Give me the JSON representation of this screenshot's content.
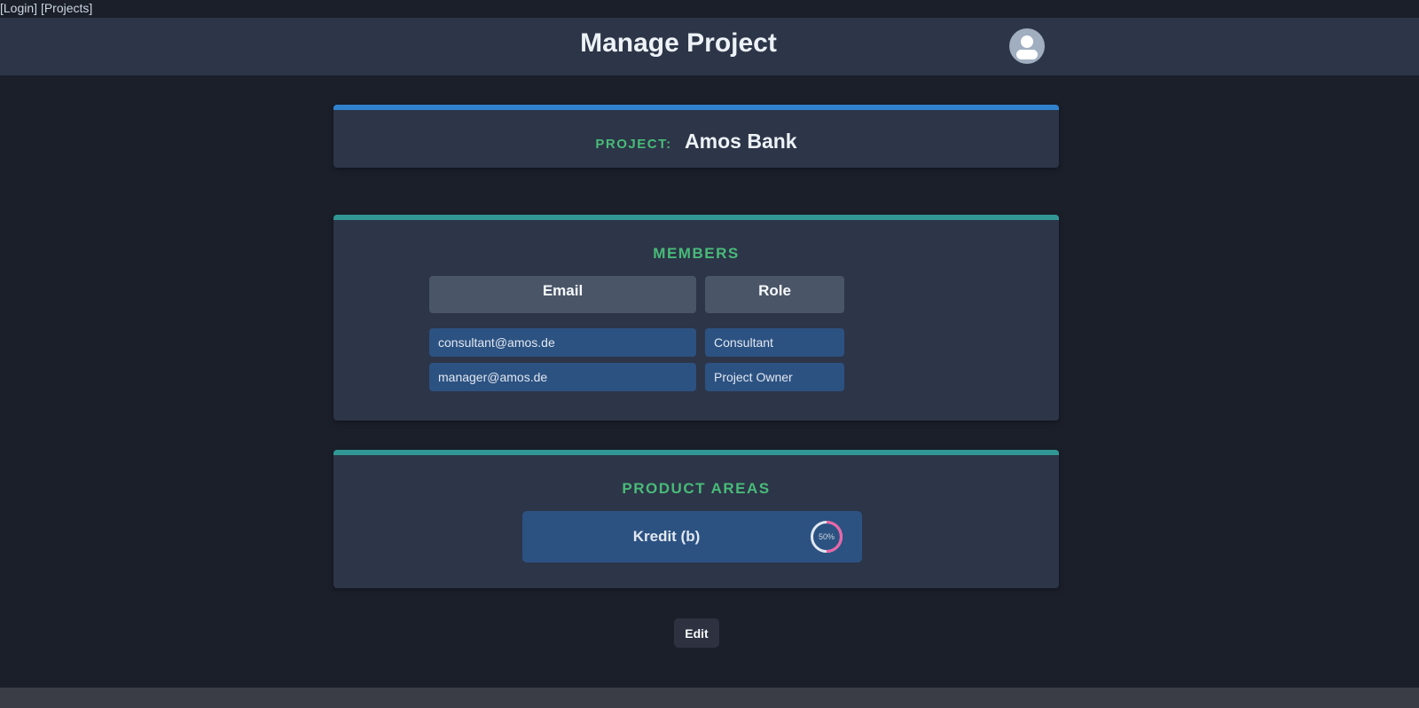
{
  "nav": {
    "login": "[Login]",
    "projects": "[Projects]"
  },
  "header": {
    "title": "Manage Project",
    "avatar_icon": "user-avatar-icon"
  },
  "project": {
    "label": "PROJECT:",
    "name": "Amos Bank"
  },
  "members": {
    "title": "MEMBERS",
    "columns": [
      "Email",
      "Role"
    ],
    "rows": [
      {
        "email": "consultant@amos.de",
        "role": "Consultant"
      },
      {
        "email": "manager@amos.de",
        "role": "Project Owner"
      }
    ]
  },
  "product_areas": {
    "title": "PRODUCT AREAS",
    "items": [
      {
        "name": "Kredit (b)",
        "progress_label": "50%",
        "progress": 0.5
      }
    ]
  },
  "actions": {
    "edit": "Edit"
  },
  "colors": {
    "accent_blue": "#3182ce",
    "accent_teal": "#319795",
    "section_green": "#48bb78",
    "progress_pink": "#ed64a6"
  }
}
